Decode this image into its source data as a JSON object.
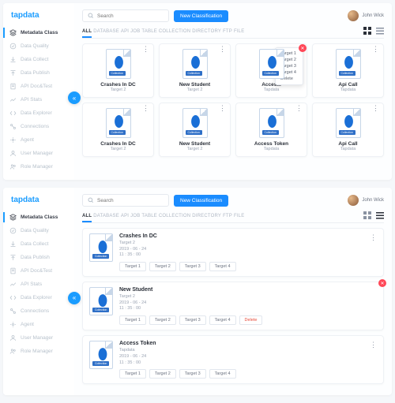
{
  "brand": "tapdata",
  "user": {
    "name": "John Wick"
  },
  "search": {
    "placeholder": "Search"
  },
  "actions": {
    "new_classification": "New Classification"
  },
  "sidebar": {
    "items": [
      {
        "label": "Metadata Class",
        "icon": "layers-icon",
        "active": true
      },
      {
        "label": "Data Quality",
        "icon": "check-icon"
      },
      {
        "label": "Data Collect",
        "icon": "download-icon"
      },
      {
        "label": "Data Publish",
        "icon": "upload-icon"
      },
      {
        "label": "API Doc&Test",
        "icon": "doc-icon"
      },
      {
        "label": "API Stats",
        "icon": "stats-icon"
      },
      {
        "label": "Data Explorer",
        "icon": "code-icon"
      },
      {
        "label": "Connections",
        "icon": "link-icon"
      },
      {
        "label": "Agent",
        "icon": "agent-icon"
      },
      {
        "label": "User Manager",
        "icon": "user-icon"
      },
      {
        "label": "Role Manager",
        "icon": "role-icon"
      }
    ]
  },
  "tabs": [
    "ALL",
    "DATABASE",
    "API",
    "JOB",
    "TABLE",
    "COLLECTION",
    "DIRECTORY",
    "FTP",
    "FILE"
  ],
  "active_tab": "ALL",
  "thumb_tag": "Collection",
  "grid_view": {
    "menu_items": [
      "Target 1",
      "Target 2",
      "Target 3",
      "Target 4",
      "Delete"
    ],
    "cards": [
      {
        "title": "Crashes In DC",
        "sub": "Target 2"
      },
      {
        "title": "New Student",
        "sub": "Target 2"
      },
      {
        "title": "Acces...",
        "sub": "Tapdata",
        "menu_open": true
      },
      {
        "title": "Api Call",
        "sub": "Tapdata"
      },
      {
        "title": "Crashes In DC",
        "sub": "Target 2"
      },
      {
        "title": "New Student",
        "sub": "Target 2"
      },
      {
        "title": "Access Token",
        "sub": "Tapdata"
      },
      {
        "title": "Api Call",
        "sub": "Tapdata"
      }
    ]
  },
  "list_view": {
    "chips": [
      "Target 1",
      "Target 2",
      "Target 3",
      "Target 4"
    ],
    "delete_label": "Delete",
    "rows": [
      {
        "title": "Crashes In DC",
        "sub": "Target 2",
        "date": "2019 - 06 - 24",
        "time": "11 : 35 : 00"
      },
      {
        "title": "New Student",
        "sub": "Target 2",
        "date": "2019 - 06 - 24",
        "time": "11 : 35 : 00",
        "delete_open": true
      },
      {
        "title": "Access Token",
        "sub": "Tapdata",
        "date": "2019 - 06 - 24",
        "time": "11 : 35 : 00"
      }
    ]
  }
}
